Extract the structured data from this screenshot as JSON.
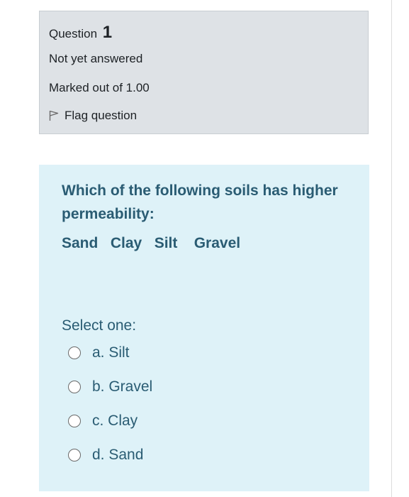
{
  "info": {
    "question_label": "Question",
    "question_number": "1",
    "state": "Not yet answered",
    "grade": "Marked out of 1.00",
    "flag_label": "Flag question"
  },
  "content": {
    "question_text": "Which of the following soils  has higher permeability:",
    "options_line": "Sand   Clay   Silt    Gravel",
    "prompt": "Select one:",
    "answers": [
      {
        "label": "a. Silt"
      },
      {
        "label": "b. Gravel"
      },
      {
        "label": "c. Clay"
      },
      {
        "label": "d. Sand"
      }
    ]
  },
  "colors": {
    "info_bg": "#dee2e6",
    "content_bg": "#def2f8",
    "content_text": "#2a5c73"
  }
}
